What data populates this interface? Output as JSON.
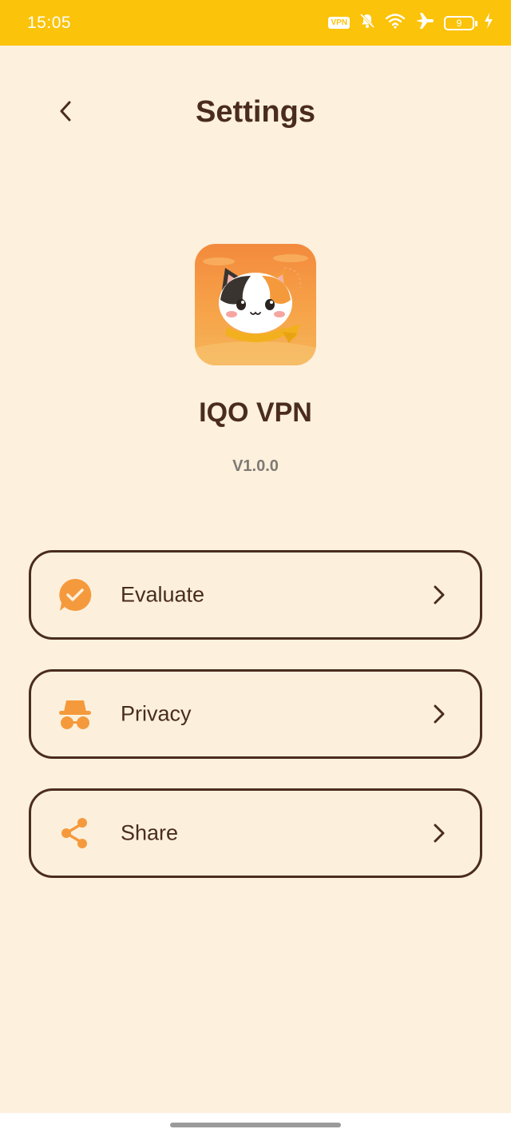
{
  "status_bar": {
    "time": "15:05",
    "vpn_badge": "VPN",
    "battery_level": "9",
    "icons": [
      "vpn-badge",
      "bell-muted-icon",
      "wifi-icon",
      "airplane-icon",
      "battery-icon",
      "charging-icon"
    ]
  },
  "header": {
    "title": "Settings",
    "back_icon": "chevron-left-icon"
  },
  "app": {
    "name": "IQO VPN",
    "version": "V1.0.0",
    "logo": "cat-logo"
  },
  "menu": {
    "items": [
      {
        "label": "Evaluate",
        "icon": "rating-chat-icon"
      },
      {
        "label": "Privacy",
        "icon": "incognito-icon"
      },
      {
        "label": "Share",
        "icon": "share-icon"
      }
    ]
  },
  "colors": {
    "status_bar": "#fbc30a",
    "background": "#fdf0dd",
    "text_dark": "#4a2c1e",
    "accent_orange": "#f59a3c",
    "version_gray": "#7f7a74"
  }
}
